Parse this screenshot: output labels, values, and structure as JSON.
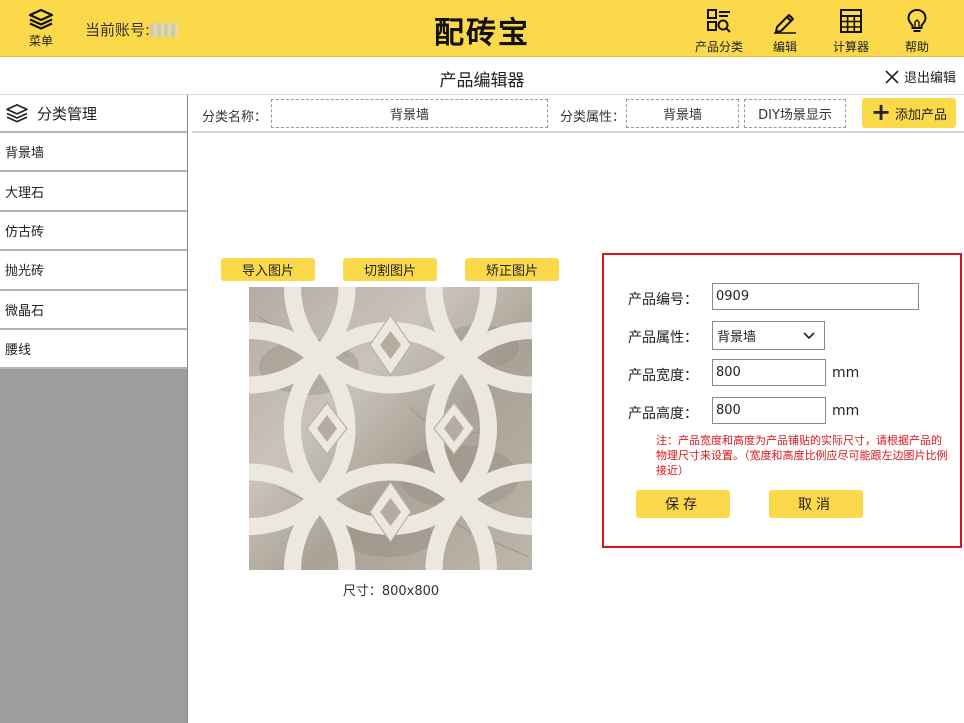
{
  "header": {
    "menu_label": "菜单",
    "account_label": "当前账号:",
    "brand": "配砖宝",
    "actions": [
      {
        "label": "产品分类",
        "icon": "category-search-icon"
      },
      {
        "label": "编辑",
        "icon": "pencil-icon"
      },
      {
        "label": "计算器",
        "icon": "calculator-icon"
      },
      {
        "label": "帮助",
        "icon": "lightbulb-icon"
      }
    ]
  },
  "titlebar": {
    "title": "产品编辑器",
    "exit_label": "退出编辑"
  },
  "sidebar": {
    "heading": "分类管理",
    "items": [
      {
        "label": "背景墙"
      },
      {
        "label": "大理石"
      },
      {
        "label": "仿古砖"
      },
      {
        "label": "抛光砖"
      },
      {
        "label": "微晶石"
      },
      {
        "label": "腰线"
      }
    ]
  },
  "filterbar": {
    "category_name_label": "分类名称：",
    "category_name_value": "背景墙",
    "category_attr_label": "分类属性：",
    "category_attr_value": "背景墙",
    "diy_label": "DIY场景显示",
    "add_label": "添加产品"
  },
  "image_panel": {
    "import_label": "导入图片",
    "cut_label": "切割图片",
    "correct_label": "矫正图片",
    "size_prefix": "尺寸：",
    "size_value": "800x800"
  },
  "form": {
    "code_label": "产品编号：",
    "code_value": "0909",
    "attr_label": "产品属性：",
    "attr_value": "背景墙",
    "width_label": "产品宽度：",
    "width_value": "800",
    "height_label": "产品高度：",
    "height_value": "800",
    "unit": "mm",
    "note": "注：产品宽度和高度为产品铺贴的实际尺寸，请根据产品的物理尺寸来设置。（宽度和高度比例应尽可能跟左边图片比例接近）",
    "save_label": "保存",
    "cancel_label": "取消"
  },
  "colors": {
    "accent_yellow": "#fcd94a",
    "alert_red": "#e0131a",
    "sidebar_gray": "#9e9e9e"
  }
}
